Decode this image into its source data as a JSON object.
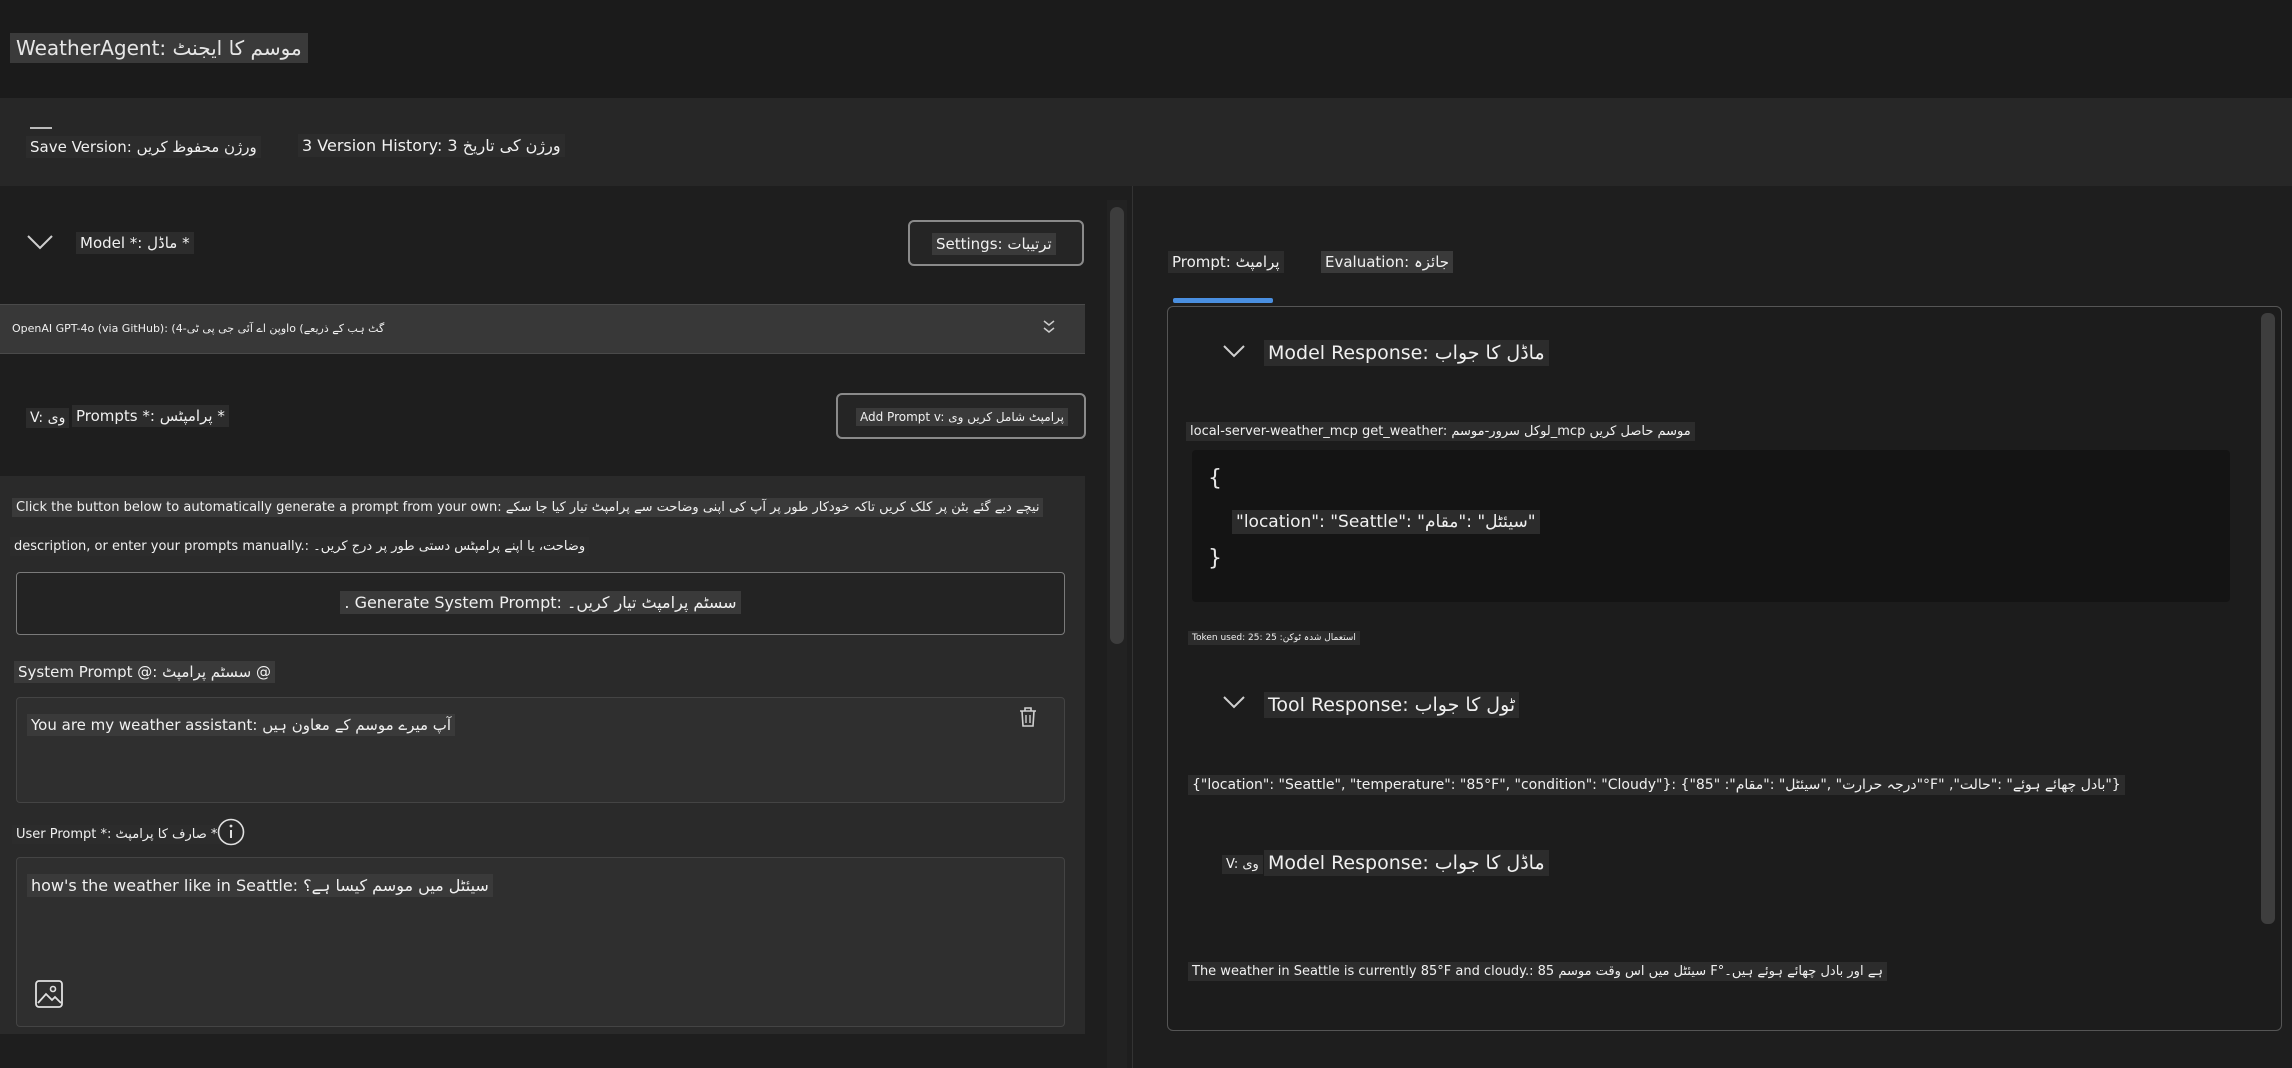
{
  "app": {
    "title": "WeatherAgent: موسم کا ایجنٹ"
  },
  "toolbar": {
    "save_version": "Save Version: ورژن محفوظ کریں",
    "version_history": "3 Version History: 3 ورژن کی تاریخ"
  },
  "model_section": {
    "label": "Model *: ماڈل *",
    "settings_label": "Settings: ترتیبات",
    "selected_model": "OpenAI GPT-4o (via GitHub): (اوپن اے آئی جی پی ٹی-4o (گٹ ہب کے ذریعے"
  },
  "prompts_section": {
    "version_badge": "V: وی",
    "label": "Prompts *: پرامپٹس *",
    "add_prompt_label": "Add Prompt v: پرامپٹ شامل کریں وی",
    "help_line_1": "Click the button below to automatically generate a prompt from your own: نیچے دیے گئے بٹن پر کلک کریں تاکہ خودکار طور پر آپ کی اپنی وضاحت سے پرامپٹ تیار کیا جا سکے",
    "help_line_2": "description, or enter your prompts manually.: وضاحت، یا اپنے پرامپٹس دستی طور پر درج کریں۔",
    "generate_label": ". Generate System Prompt: سسٹم پرامپٹ تیار کریں۔",
    "system_prompt_label": "System Prompt @: سسٹم پرامپٹ @",
    "system_prompt_value": "You are my weather assistant: آپ میرے موسم کے معاون ہیں",
    "user_prompt_label": "User Prompt *: صارف کا پرامپٹ *",
    "user_prompt_value": "how's the weather like in Seattle: سیئٹل میں موسم کیسا ہے؟"
  },
  "tabs": {
    "prompt": "Prompt: پرامپٹ",
    "evaluation": "Evaluation: جائزہ"
  },
  "results": {
    "model_response_label": "Model Response: ماڈل کا جواب",
    "tool_call": "local-server-weather_mcp get_weather: لوکل سرور-موسم_mcp موسم حاصل کریں",
    "code_open": "{",
    "code_body": "\"location\": \"Seattle\": \"سیئٹل\" :\"مقام\"",
    "code_close": "}",
    "tokens_used": "Token used: 25: استعمال شدہ ٹوکن: 25",
    "tool_response_label": "Tool Response: ٹول کا جواب",
    "tool_response_body": "{\"location\": \"Seattle\", \"temperature\": \"85°F\", \"condition\": \"Cloudy\"}: {\"85\" :\"درجہ حرارت\" ,\"سیئٹل\" :\"مقام\"°F\" ,\"بادل چھائے ہوئے\" :\"حالت\"}",
    "version_badge": "V: وی",
    "model_response_label_2": "Model Response: ماڈل کا جواب",
    "final_answer": "The weather in Seattle is currently 85°F and cloudy.: 85 سیئٹل میں اس وقت موسم F°ہے اور بادل چھائے ہوئے ہیں۔"
  },
  "colors": {
    "accent": "#4a8fe0",
    "background": "#1e1e1e"
  }
}
